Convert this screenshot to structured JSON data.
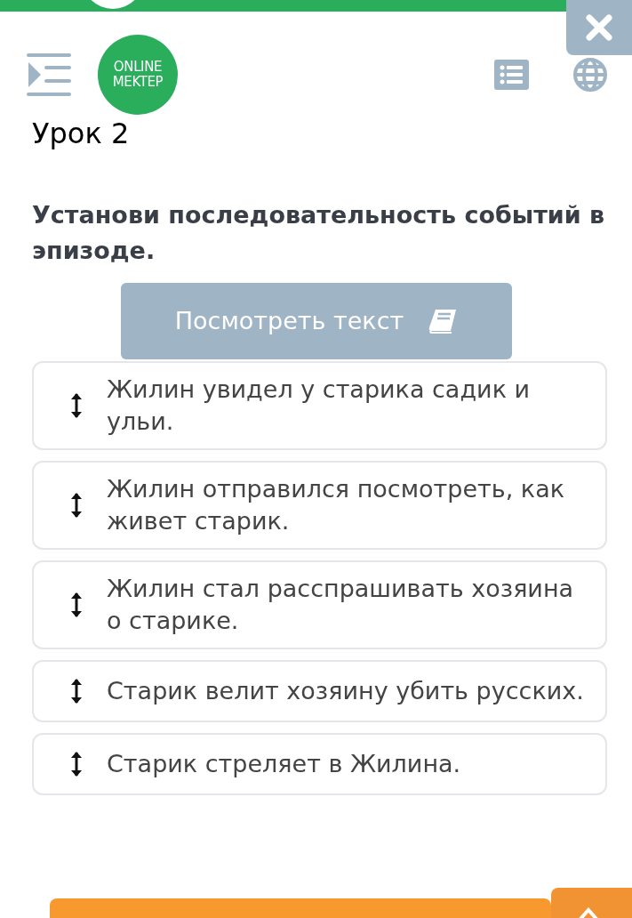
{
  "header": {
    "logo": [
      "ONLINE",
      "MEKTEP"
    ]
  },
  "lesson_title": "Урок 2",
  "task": "Установи последовательность событий в эпизоде.",
  "view_text_button": "Посмотреть текст",
  "items": [
    {
      "text": "Жилин увидел у старика садик и ульи."
    },
    {
      "text": "Жилин отправился посмотреть, как живет старик."
    },
    {
      "text": "Жилин стал расспрашивать хозяина о старике."
    },
    {
      "text": "Старик велит хозяину убить русских."
    },
    {
      "text": "Старик стреляет в Жилина."
    }
  ]
}
